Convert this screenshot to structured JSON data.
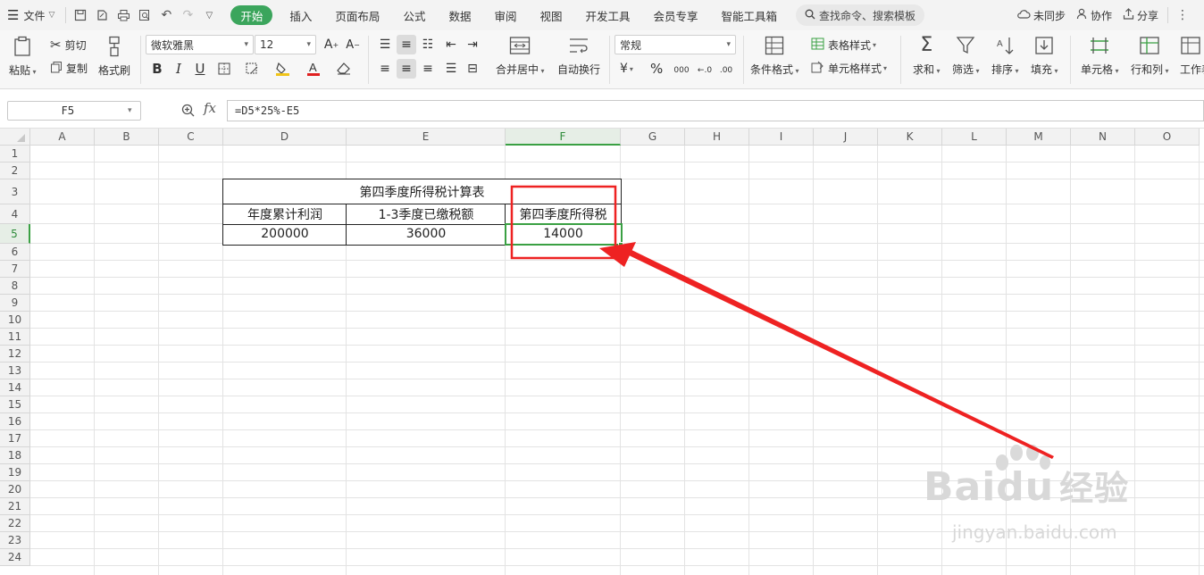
{
  "menubar": {
    "file_label": "文件",
    "tabs": [
      {
        "label": "开始",
        "active": true
      },
      {
        "label": "插入"
      },
      {
        "label": "页面布局"
      },
      {
        "label": "公式"
      },
      {
        "label": "数据"
      },
      {
        "label": "审阅"
      },
      {
        "label": "视图"
      },
      {
        "label": "开发工具"
      },
      {
        "label": "会员专享"
      },
      {
        "label": "智能工具箱"
      }
    ],
    "search_placeholder": "查找命令、搜索模板",
    "sync_label": "未同步",
    "collab_label": "协作",
    "share_label": "分享"
  },
  "ribbon": {
    "paste": "粘贴",
    "cut": "剪切",
    "copy": "复制",
    "format_painter": "格式刷",
    "font_name": "微软雅黑",
    "font_size": "12",
    "merge_center": "合并居中",
    "wrap_text": "自动换行",
    "number_format": "常规",
    "conditional_format": "条件格式",
    "table_style": "表格样式",
    "cell_style": "单元格样式",
    "sum": "求和",
    "filter": "筛选",
    "sort": "排序",
    "fill": "填充",
    "cell": "单元格",
    "row_col": "行和列",
    "worksheet": "工作表",
    "percent_symbol": "%",
    "currency_symbol": "¥"
  },
  "formula_bar": {
    "name_box": "F5",
    "fx": "fx",
    "formula": "=D5*25%-E5"
  },
  "columns": [
    "A",
    "B",
    "C",
    "D",
    "E",
    "F",
    "G",
    "H",
    "I",
    "J",
    "K",
    "L",
    "M",
    "N",
    "O"
  ],
  "selected_column": "F",
  "rows": [
    "1",
    "2",
    "3",
    "4",
    "5",
    "6",
    "7",
    "8",
    "9",
    "10",
    "11",
    "12",
    "13",
    "14",
    "15",
    "16",
    "17",
    "18",
    "19",
    "20",
    "21",
    "22",
    "23",
    "24"
  ],
  "selected_row": "5",
  "sheet": {
    "title": "第四季度所得税计算表",
    "headers": [
      "年度累计利润",
      "1-3季度已缴税额",
      "第四季度所得税"
    ],
    "values": [
      "200000",
      "36000",
      "14000"
    ]
  },
  "watermark": {
    "brand": "Baidu",
    "brand_cn": "经验",
    "url": "jingyan.baidu.com"
  },
  "colors": {
    "accent_green": "#3ba55c",
    "annotation_red": "#ee2222",
    "selection_green": "#3aa043"
  }
}
